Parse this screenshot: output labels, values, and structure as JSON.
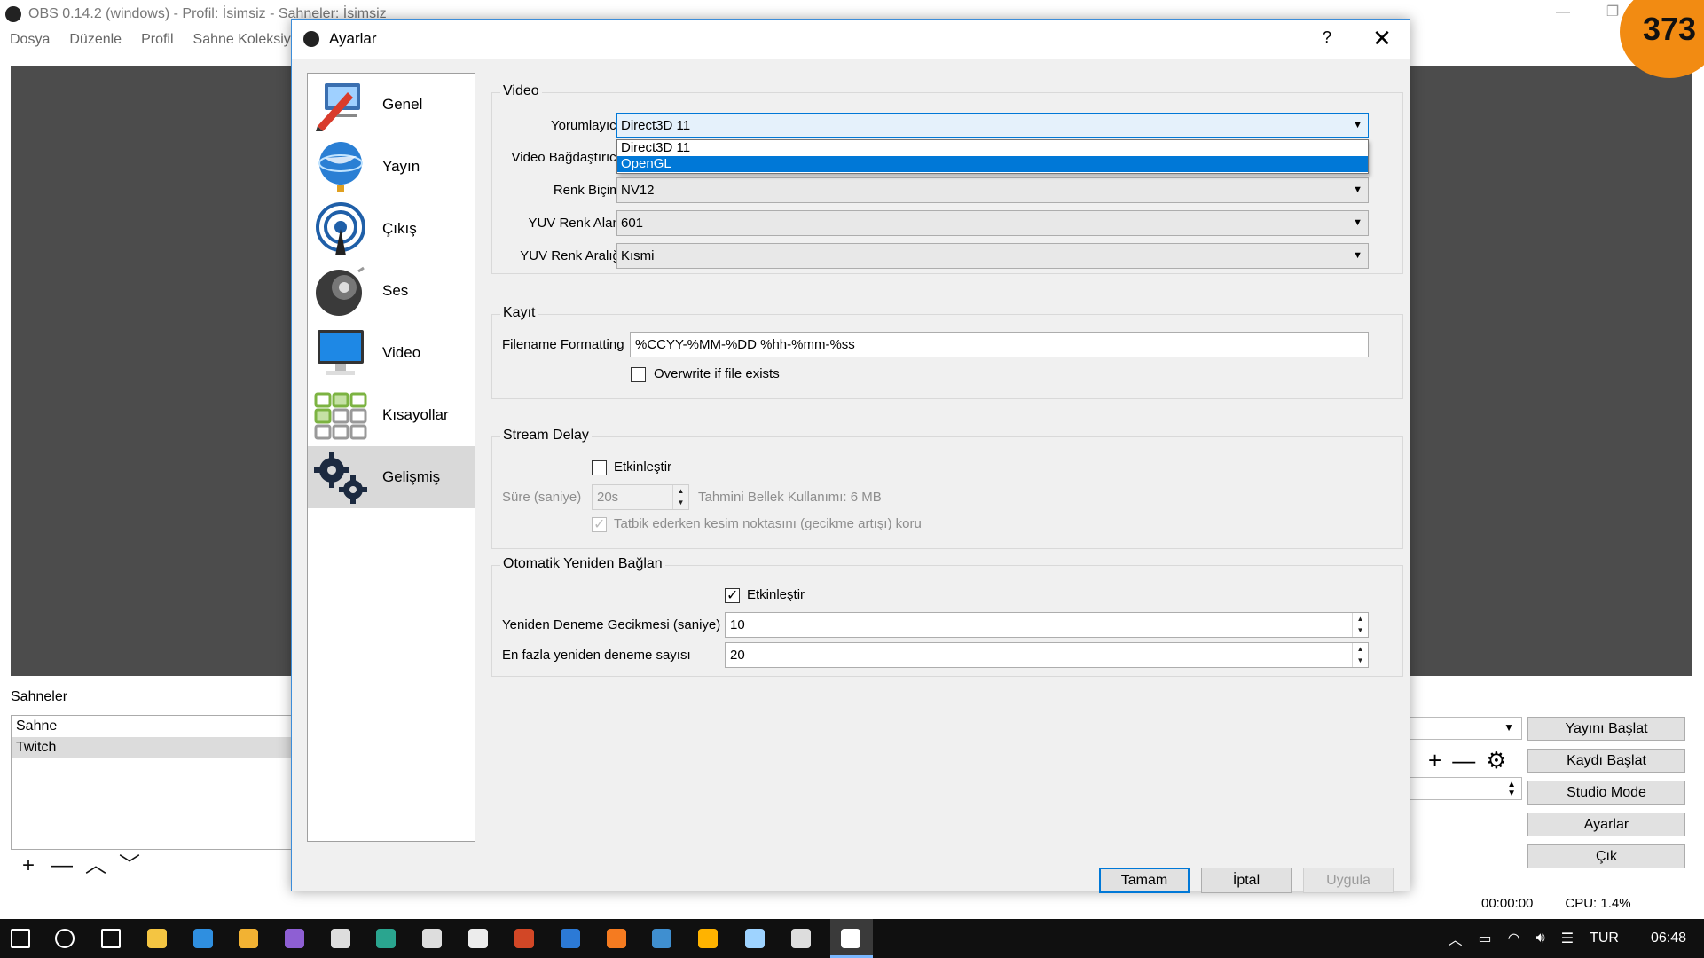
{
  "obs_window": {
    "title": "OBS 0.14.2 (windows) - Profil: İsimsiz - Sahneler: İsimsiz",
    "menu": [
      "Dosya",
      "Düzenle",
      "Profil",
      "Sahne Koleksiyonu"
    ],
    "scenes_label": "Sahneler",
    "scenes": [
      "Sahne",
      "Twitch"
    ],
    "scene_tools": [
      "+",
      "—",
      "︿",
      "﹀"
    ],
    "mixer_tools": [
      "+",
      "—",
      "⚙"
    ],
    "controls": [
      "Yayını Başlat",
      "Kaydı Başlat",
      "Studio Mode",
      "Ayarlar",
      "Çık"
    ],
    "status_time": "00:00:00",
    "status_cpu": "CPU: 1.4%",
    "minimize": "—",
    "maximize": "❐"
  },
  "badge": "373",
  "dialog": {
    "title": "Ayarlar",
    "help": "?",
    "close": "✕",
    "categories": [
      {
        "label": "Genel",
        "icon": "pencil-monitor-icon",
        "color": "#d93b2b"
      },
      {
        "label": "Yayın",
        "icon": "globe-icon",
        "color": "#2a7fd4"
      },
      {
        "label": "Çıkış",
        "icon": "broadcast-icon",
        "color": "#1f5fa8"
      },
      {
        "label": "Ses",
        "icon": "speaker-icon",
        "color": "#444444"
      },
      {
        "label": "Video",
        "icon": "monitor-icon",
        "color": "#1e88e5"
      },
      {
        "label": "Kısayollar",
        "icon": "keyboard-icon",
        "color": "#7cb342"
      },
      {
        "label": "Gelişmiş",
        "icon": "gears-icon",
        "color": "#1c2a40"
      }
    ],
    "active_category": "Gelişmiş",
    "video_group": {
      "title": "Video",
      "renderer_label": "Yorumlayıcı:",
      "renderer_value": "Direct3D 11",
      "renderer_options": [
        "Direct3D 11",
        "OpenGL"
      ],
      "renderer_highlighted": "OpenGL",
      "adapter_label": "Video Bağdaştırıcı:",
      "color_format_label": "Renk Biçimi",
      "color_format_value": "NV12",
      "yuv_space_label": "YUV Renk Alanı",
      "yuv_space_value": "601",
      "yuv_range_label": "YUV Renk Aralığı",
      "yuv_range_value": "Kısmi"
    },
    "recording_group": {
      "title": "Kayıt",
      "filename_label": "Filename Formatting",
      "filename_value": "%CCYY-%MM-%DD %hh-%mm-%ss",
      "overwrite_label": "Overwrite if file exists",
      "overwrite_checked": false
    },
    "stream_delay_group": {
      "title": "Stream Delay",
      "enable_label": "Etkinleştir",
      "enable_checked": false,
      "duration_label": "Süre (saniye)",
      "duration_value": "20s",
      "memory_label": "Tahmini Bellek Kullanımı: 6 MB",
      "preserve_label": "Tatbik ederken kesim noktasını (gecikme artışı) koru",
      "preserve_checked": true
    },
    "reconnect_group": {
      "title": "Otomatik Yeniden Bağlan",
      "enable_label": "Etkinleştir",
      "enable_checked": true,
      "retry_delay_label": "Yeniden Deneme Gecikmesi (saniye)",
      "retry_delay_value": "10",
      "max_retries_label": "En fazla yeniden deneme sayısı",
      "max_retries_value": "20"
    },
    "buttons": {
      "ok": "Tamam",
      "cancel": "İptal",
      "apply": "Uygula"
    }
  },
  "taskbar": {
    "apps": [
      {
        "icon": "windows-start-icon",
        "color": "#ffffff"
      },
      {
        "icon": "search-icon",
        "color": "#ffffff"
      },
      {
        "icon": "task-view-icon",
        "color": "#ffffff"
      },
      {
        "icon": "file-explorer-icon",
        "color": "#f4c542"
      },
      {
        "icon": "edge-icon",
        "color": "#2f8fe0"
      },
      {
        "icon": "chrome-icon",
        "color": "#f2b233"
      },
      {
        "icon": "visual-studio-icon",
        "color": "#8e5fd3"
      },
      {
        "icon": "tool-app-icon",
        "color": "#dddddd"
      },
      {
        "icon": "sway-icon",
        "color": "#2aa58f"
      },
      {
        "icon": "media-app-icon",
        "color": "#dddddd"
      },
      {
        "icon": "paint-app-icon",
        "color": "#ececec"
      },
      {
        "icon": "powerpoint-icon",
        "color": "#d24726"
      },
      {
        "icon": "outlook-app-icon",
        "color": "#2c7ad6"
      },
      {
        "icon": "origin-app-icon",
        "color": "#f57b20"
      },
      {
        "icon": "steam-icon",
        "color": "#3f8fd0"
      },
      {
        "icon": "burn-app-icon",
        "color": "#ffb300"
      },
      {
        "icon": "package-app-icon",
        "color": "#9ed3ff"
      },
      {
        "icon": "graphics-app-icon",
        "color": "#dddddd"
      },
      {
        "icon": "obs-icon",
        "color": "#ffffff"
      }
    ],
    "language": "TUR",
    "clock": "06:48"
  }
}
